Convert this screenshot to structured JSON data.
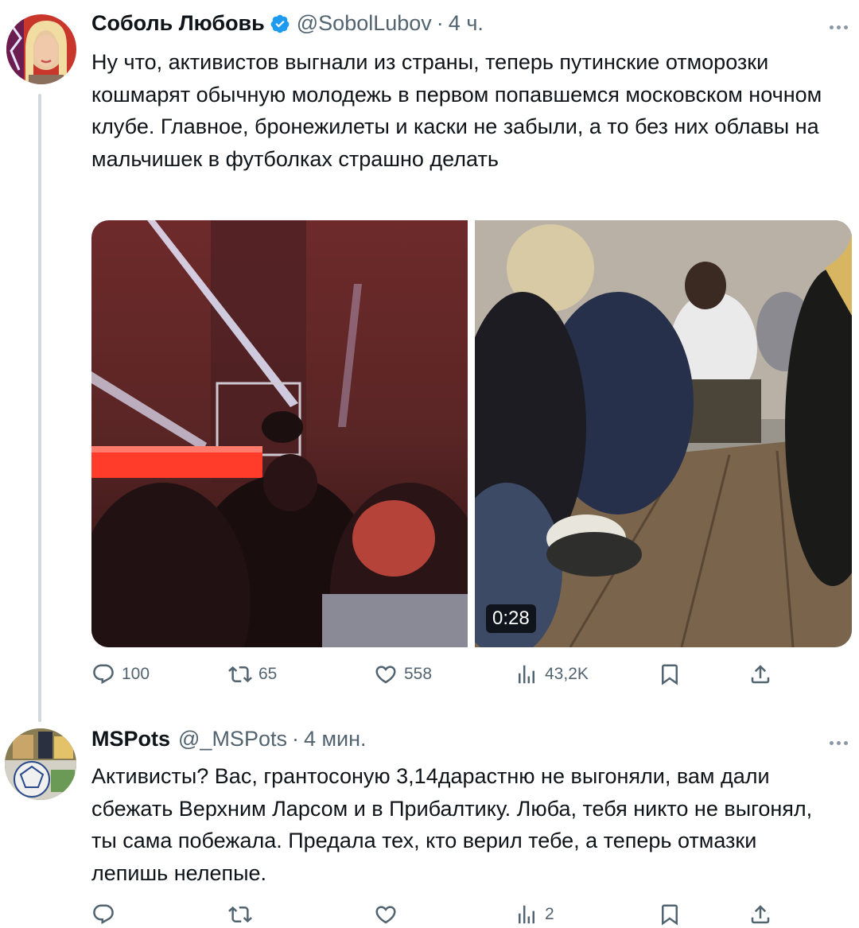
{
  "tweet1": {
    "name": "Соболь Любовь",
    "handle": "@SobolLubov",
    "separator": "·",
    "time": "4 ч.",
    "text": "Ну что, активистов выгнали из страны, теперь путинские отморозки кошмарят обычную молодежь в первом попавшемся московском ночном клубе. Главное, бронежилеты и каски не забыли, а то без них облавы на мальчишек в футболках страшно делать",
    "media": {
      "video_duration": "0:28"
    },
    "actions": {
      "replies": "100",
      "retweets": "65",
      "likes": "558",
      "views": "43,2K"
    }
  },
  "tweet2": {
    "name": "MSPots",
    "handle": "@_MSPots",
    "separator": "·",
    "time": "4 мин.",
    "text": "Активисты? Вас, грантосоную 3,14дарастню не выгоняли, вам дали сбежать Верхним Ларсом и в Прибалтику. Люба, тебя никто не выгонял, ты сама побежала. Предала тех, кто верил тебе, а теперь отмазки лепишь нелепые.",
    "actions": {
      "replies": "",
      "retweets": "",
      "likes": "",
      "views": "2"
    }
  },
  "colors": {
    "text": "#0f1419",
    "secondary": "#536471",
    "verified_blue": "#1d9bf0",
    "thread_line": "#cfd9de"
  },
  "icons": [
    "verified-badge-icon",
    "more-icon",
    "reply-icon",
    "retweet-icon",
    "like-icon",
    "views-icon",
    "bookmark-icon",
    "share-icon"
  ]
}
